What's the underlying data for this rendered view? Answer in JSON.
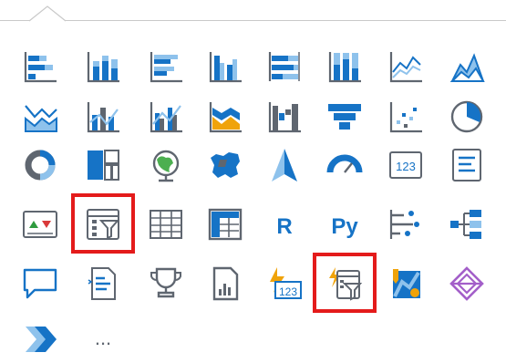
{
  "colors": {
    "icon_blue": "#1673c6",
    "icon_gray": "#5f6670",
    "icon_light_blue": "#8ec2ec",
    "highlight_red": "#e41b1b",
    "accent_orange": "#f0a30a",
    "accent_purple": "#a35fc9"
  },
  "gallery": {
    "rows": [
      [
        "stacked-bar-chart-icon",
        "stacked-column-chart-icon",
        "clustered-bar-chart-icon",
        "clustered-column-chart-icon",
        "100-percent-stacked-bar-chart-icon",
        "100-percent-stacked-column-chart-icon",
        "line-chart-icon",
        "area-chart-icon"
      ],
      [
        "stacked-area-chart-icon",
        "line-and-stacked-column-chart-icon",
        "line-and-clustered-column-chart-icon",
        "ribbon-chart-icon",
        "waterfall-chart-icon",
        "funnel-chart-icon",
        "scatter-chart-icon",
        "pie-chart-icon"
      ],
      [
        "donut-chart-icon",
        "treemap-icon",
        "map-icon",
        "filled-map-icon",
        "azure-map-icon",
        "gauge-icon",
        "card-icon",
        "multi-row-card-icon"
      ],
      [
        "kpi-icon",
        "slicer-icon",
        "table-icon",
        "matrix-icon",
        "r-script-visual-icon",
        "python-visual-icon",
        "key-influencers-icon",
        "decomposition-tree-icon"
      ],
      [
        "q-and-a-icon",
        "smart-narrative-icon",
        "metrics-icon",
        "paginated-report-icon",
        "power-apps-icon",
        "power-automate-icon",
        "arcgis-maps-icon",
        "power-apps-for-power-bi-icon"
      ],
      [
        "power-automate-flow-icon",
        "more-options-icon"
      ]
    ],
    "labels": {
      "r_visual": "R",
      "python_visual": "Py",
      "card_value": "123",
      "power_apps_value": "123",
      "more": "..."
    },
    "highlighted": [
      "slicer-icon",
      "power-automate-icon"
    ]
  }
}
